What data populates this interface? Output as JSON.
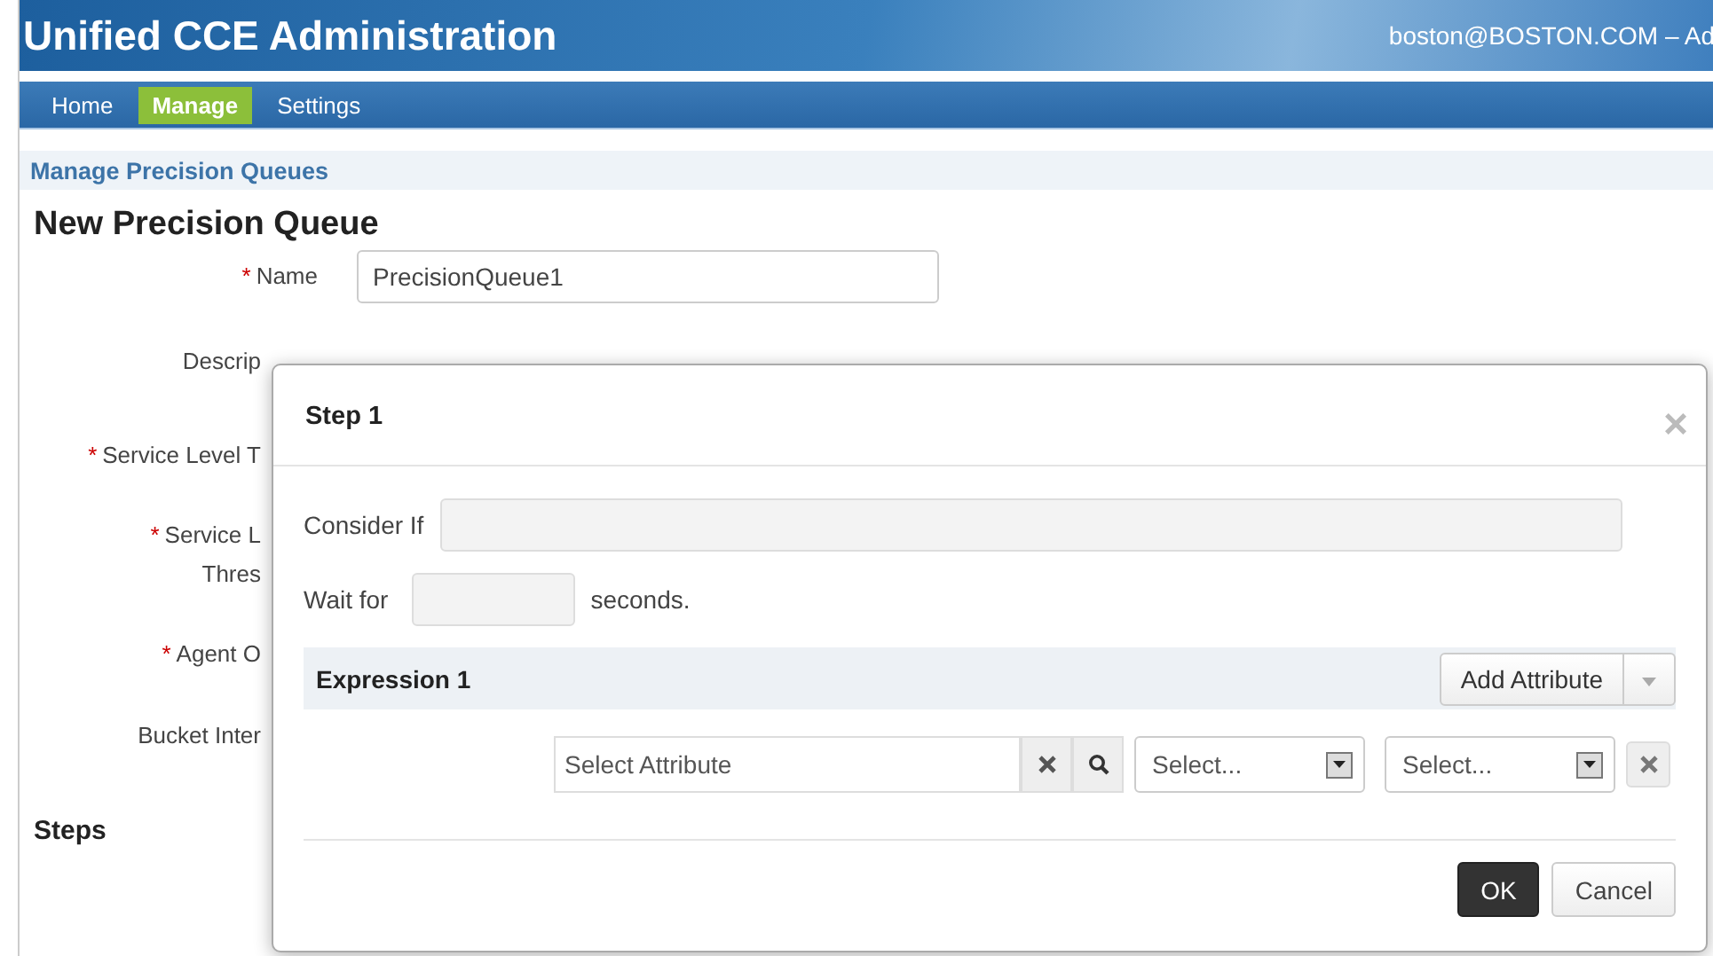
{
  "header": {
    "title": "Unified CCE Administration",
    "user": "boston@BOSTON.COM – Ad"
  },
  "nav": [
    {
      "label": "Home",
      "selected": false
    },
    {
      "label": "Manage",
      "selected": true
    },
    {
      "label": "Settings",
      "selected": false
    }
  ],
  "breadcrumb": "Manage Precision Queues",
  "page_title": "New Precision Queue",
  "form": [
    {
      "kind": "field",
      "marker": "*",
      "lines": [
        "Name"
      ],
      "value": "PrecisionQueue1"
    },
    {
      "kind": "covered",
      "lines": [
        "Descrip"
      ]
    },
    {
      "kind": "covered",
      "marker": "*",
      "lines": [
        "Service Level T"
      ]
    },
    {
      "kind": "covered",
      "marker": "*",
      "lines": [
        "Service L",
        "Thres"
      ]
    },
    {
      "kind": "covered",
      "marker": "*",
      "lines": [
        "Agent O"
      ]
    },
    {
      "kind": "covered",
      "lines": [
        "Bucket Inter"
      ]
    }
  ],
  "steps_heading": "Steps",
  "dialog": {
    "title": "Step 1",
    "close": "×",
    "consider_label": "Consider If",
    "wait_label": "Wait for",
    "wait_suffix": "seconds.",
    "expression": {
      "title": "Expression 1",
      "add_button": "Add Attribute",
      "attribute_placeholder": "Select Attribute",
      "operator": "Select...",
      "value": "Select..."
    },
    "buttons": [
      {
        "label": "OK",
        "kind": "primary"
      },
      {
        "label": "Cancel",
        "kind": "default"
      }
    ]
  }
}
